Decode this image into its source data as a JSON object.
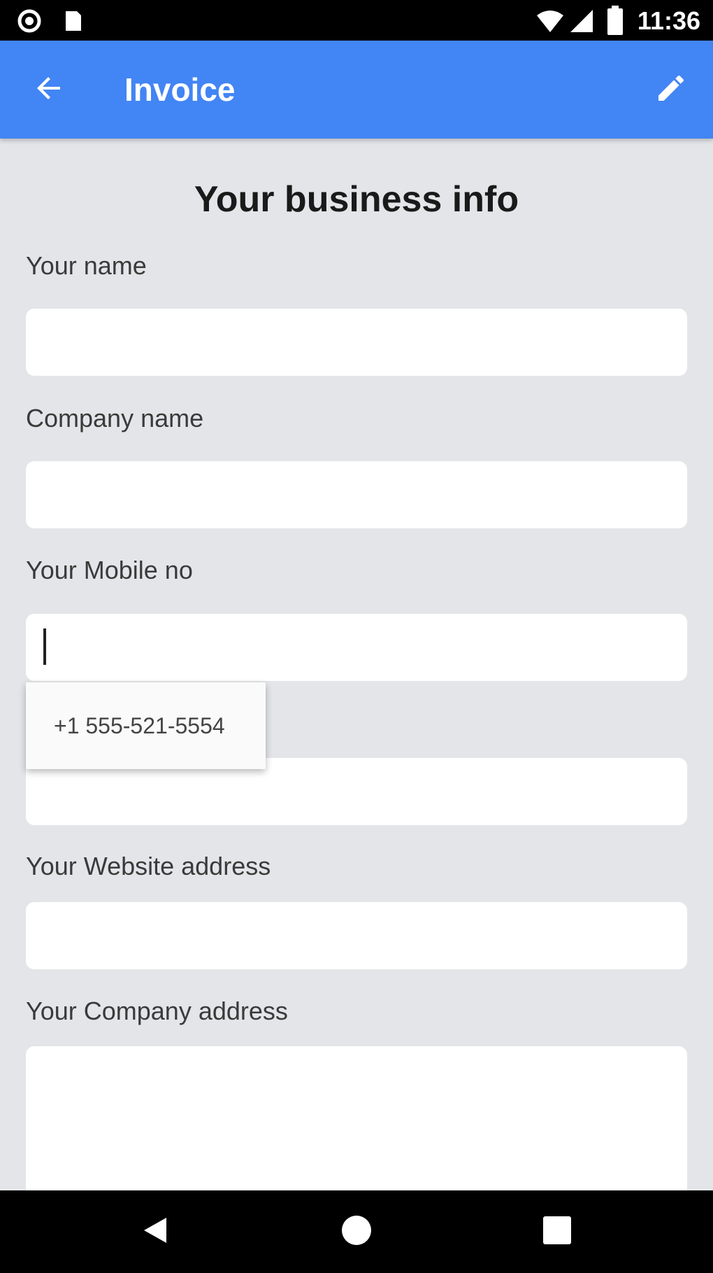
{
  "status_bar": {
    "time": "11:36",
    "icons": [
      "record-icon",
      "sim-card-icon",
      "wifi-icon",
      "signal-icon",
      "battery-icon"
    ]
  },
  "app_bar": {
    "title": "Invoice",
    "back_icon": "arrow-back-icon",
    "edit_icon": "pencil-icon",
    "color": "#4285f4"
  },
  "form": {
    "section_title": "Your business info",
    "fields": [
      {
        "label": "Your name",
        "value": "",
        "placeholder": ""
      },
      {
        "label": "Company name",
        "value": "",
        "placeholder": ""
      },
      {
        "label": "Your Mobile no",
        "value": "",
        "placeholder": ""
      },
      {
        "label": "",
        "value": "",
        "placeholder": ""
      },
      {
        "label": "Your Website address",
        "value": "",
        "placeholder": ""
      },
      {
        "label": "Your Company address",
        "value": "",
        "placeholder": ""
      }
    ]
  },
  "autofill": {
    "suggestion": "+1 555-521-5554"
  },
  "nav_bar": {
    "icons": [
      "back-triangle-icon",
      "home-circle-icon",
      "recents-square-icon"
    ]
  }
}
